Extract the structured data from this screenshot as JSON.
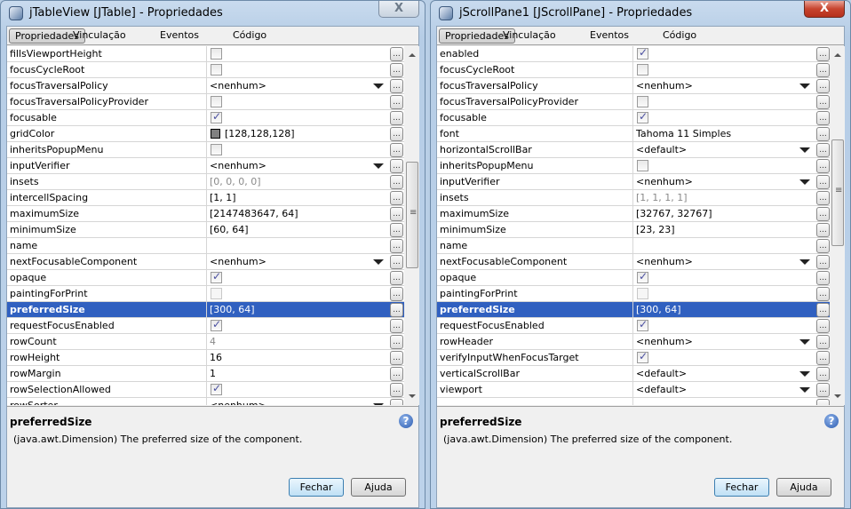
{
  "windows": [
    {
      "title": "jTableView [JTable] - Propriedades",
      "active": false,
      "close_label": "X",
      "tabs": [
        "Propriedades",
        "Vinculação",
        "Eventos",
        "Código"
      ],
      "rows": [
        {
          "name": "fillsViewportHeight",
          "type": "check",
          "checked": false
        },
        {
          "name": "focusCycleRoot",
          "type": "check",
          "checked": false
        },
        {
          "name": "focusTraversalPolicy",
          "type": "combo",
          "value": "<nenhum>"
        },
        {
          "name": "focusTraversalPolicyProvider",
          "type": "check",
          "checked": false
        },
        {
          "name": "focusable",
          "type": "check",
          "checked": true
        },
        {
          "name": "gridColor",
          "type": "color",
          "value": "[128,128,128]",
          "color": "#808080"
        },
        {
          "name": "inheritsPopupMenu",
          "type": "check",
          "checked": false
        },
        {
          "name": "inputVerifier",
          "type": "combo",
          "value": "<nenhum>"
        },
        {
          "name": "insets",
          "type": "gray",
          "value": "[0, 0, 0, 0]"
        },
        {
          "name": "intercellSpacing",
          "type": "text",
          "value": "[1, 1]"
        },
        {
          "name": "maximumSize",
          "type": "text",
          "value": "[2147483647, 64]"
        },
        {
          "name": "minimumSize",
          "type": "text",
          "value": "[60, 64]"
        },
        {
          "name": "name",
          "type": "text",
          "value": ""
        },
        {
          "name": "nextFocusableComponent",
          "type": "combo",
          "value": "<nenhum>"
        },
        {
          "name": "opaque",
          "type": "check",
          "checked": true
        },
        {
          "name": "paintingForPrint",
          "type": "checkdis",
          "checked": false
        },
        {
          "name": "preferredSize",
          "type": "text",
          "value": "[300, 64]",
          "selected": true
        },
        {
          "name": "requestFocusEnabled",
          "type": "check",
          "checked": true
        },
        {
          "name": "rowCount",
          "type": "gray",
          "value": "4"
        },
        {
          "name": "rowHeight",
          "type": "text",
          "value": "16"
        },
        {
          "name": "rowMargin",
          "type": "text",
          "value": "1"
        },
        {
          "name": "rowSelectionAllowed",
          "type": "check",
          "checked": true
        },
        {
          "name": "rowSorter",
          "type": "combo",
          "value": "<nenhum>"
        }
      ],
      "description": {
        "title": "preferredSize",
        "text": "(java.awt.Dimension) The preferred size of the component."
      },
      "buttons": {
        "close": "Fechar",
        "help": "Ajuda"
      },
      "scroll_fraction": 0.45
    },
    {
      "title": "jScrollPane1 [JScrollPane] - Propriedades",
      "active": true,
      "close_label": "X",
      "tabs": [
        "Propriedades",
        "Vinculação",
        "Eventos",
        "Código"
      ],
      "rows": [
        {
          "name": "enabled",
          "type": "check",
          "checked": true
        },
        {
          "name": "focusCycleRoot",
          "type": "check",
          "checked": false
        },
        {
          "name": "focusTraversalPolicy",
          "type": "combo",
          "value": "<nenhum>"
        },
        {
          "name": "focusTraversalPolicyProvider",
          "type": "check",
          "checked": false
        },
        {
          "name": "focusable",
          "type": "check",
          "checked": true
        },
        {
          "name": "font",
          "type": "text",
          "value": "Tahoma 11 Simples"
        },
        {
          "name": "horizontalScrollBar",
          "type": "combo",
          "value": "<default>"
        },
        {
          "name": "inheritsPopupMenu",
          "type": "check",
          "checked": false
        },
        {
          "name": "inputVerifier",
          "type": "combo",
          "value": "<nenhum>"
        },
        {
          "name": "insets",
          "type": "gray",
          "value": "[1, 1, 1, 1]"
        },
        {
          "name": "maximumSize",
          "type": "text",
          "value": "[32767, 32767]"
        },
        {
          "name": "minimumSize",
          "type": "text",
          "value": "[23, 23]"
        },
        {
          "name": "name",
          "type": "text",
          "value": ""
        },
        {
          "name": "nextFocusableComponent",
          "type": "combo",
          "value": "<nenhum>"
        },
        {
          "name": "opaque",
          "type": "check",
          "checked": true
        },
        {
          "name": "paintingForPrint",
          "type": "checkdis",
          "checked": false
        },
        {
          "name": "preferredSize",
          "type": "text",
          "value": "[300, 64]",
          "selected": true
        },
        {
          "name": "requestFocusEnabled",
          "type": "check",
          "checked": true
        },
        {
          "name": "rowHeader",
          "type": "combo",
          "value": "<nenhum>"
        },
        {
          "name": "verifyInputWhenFocusTarget",
          "type": "check",
          "checked": true
        },
        {
          "name": "verticalScrollBar",
          "type": "combo",
          "value": "<default>"
        },
        {
          "name": "viewport",
          "type": "combo",
          "value": "<default>"
        },
        {
          "name": "",
          "type": "text",
          "value": ""
        }
      ],
      "description": {
        "title": "preferredSize",
        "text": "(java.awt.Dimension) The preferred size of the component."
      },
      "buttons": {
        "close": "Fechar",
        "help": "Ajuda"
      },
      "scroll_fraction": 0.35
    }
  ]
}
